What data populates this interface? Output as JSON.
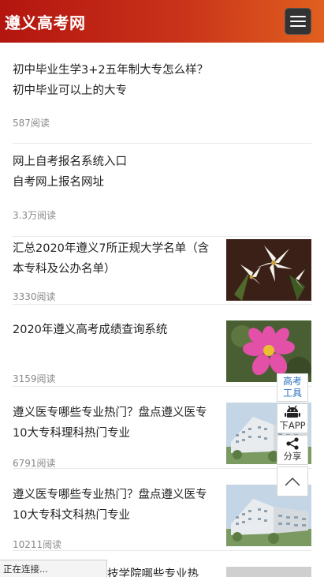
{
  "header": {
    "title": "遵义高考网"
  },
  "articles": [
    {
      "title_line1": "初中毕业生学3+2五年制大专怎么样？",
      "title_line2": "初中毕业可以上的大专",
      "reads": "587阅读"
    },
    {
      "title_line1": "网上自考报名系统入口",
      "title_line2": "自考网上报名网址",
      "reads": "3.3万阅读"
    },
    {
      "title": "汇总2020年遵义7所正规大学名单（含本专科及公办名单）",
      "reads": "3330阅读"
    },
    {
      "title": "2020年遵义高考成绩查询系统",
      "reads": "3159阅读"
    },
    {
      "title": "遵义医专哪些专业热门？盘点遵义医专10大专科理科热门专业",
      "reads": "6791阅读"
    },
    {
      "title": "遵义医专哪些专业热门？盘点遵义医专10大专科文科热门专业",
      "reads": "10211阅读"
    },
    {
      "title": "技学院哪些专业热"
    }
  ],
  "side_tools": {
    "gaokao_line1": "高考",
    "gaokao_line2": "工具",
    "app_label": "下APP",
    "share_label": "分享"
  },
  "status_bar": {
    "text": "正在连接..."
  }
}
